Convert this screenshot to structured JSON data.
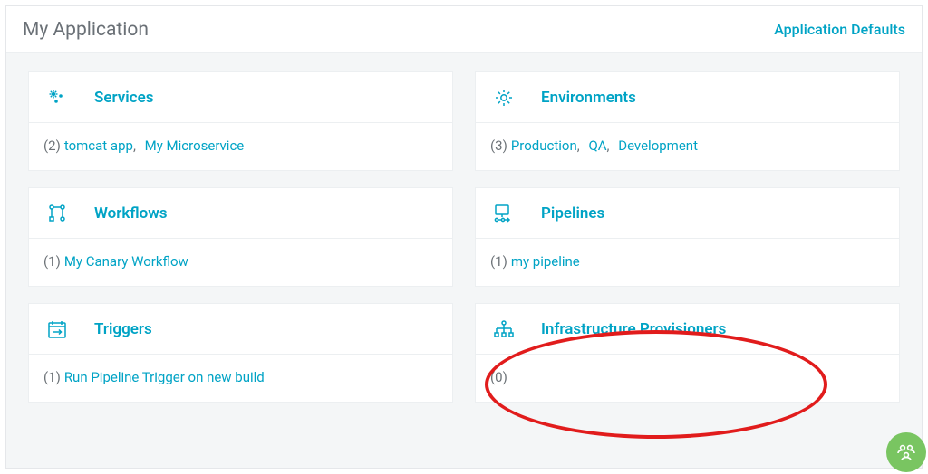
{
  "header": {
    "title": "My Application",
    "defaults_link": "Application Defaults"
  },
  "cards": {
    "services": {
      "title": "Services",
      "count": 2,
      "items": [
        "tomcat app",
        "My Microservice"
      ]
    },
    "environments": {
      "title": "Environments",
      "count": 3,
      "items": [
        "Production",
        "QA",
        "Development"
      ]
    },
    "workflows": {
      "title": "Workflows",
      "count": 1,
      "items": [
        "My Canary Workflow"
      ]
    },
    "pipelines": {
      "title": "Pipelines",
      "count": 1,
      "items": [
        "my pipeline"
      ]
    },
    "triggers": {
      "title": "Triggers",
      "count": 1,
      "items": [
        "Run Pipeline Trigger on new build"
      ]
    },
    "infraprov": {
      "title": "Infrastructure Provisioners",
      "count": 0,
      "items": []
    }
  },
  "highlight": {
    "target": "infraprov"
  }
}
